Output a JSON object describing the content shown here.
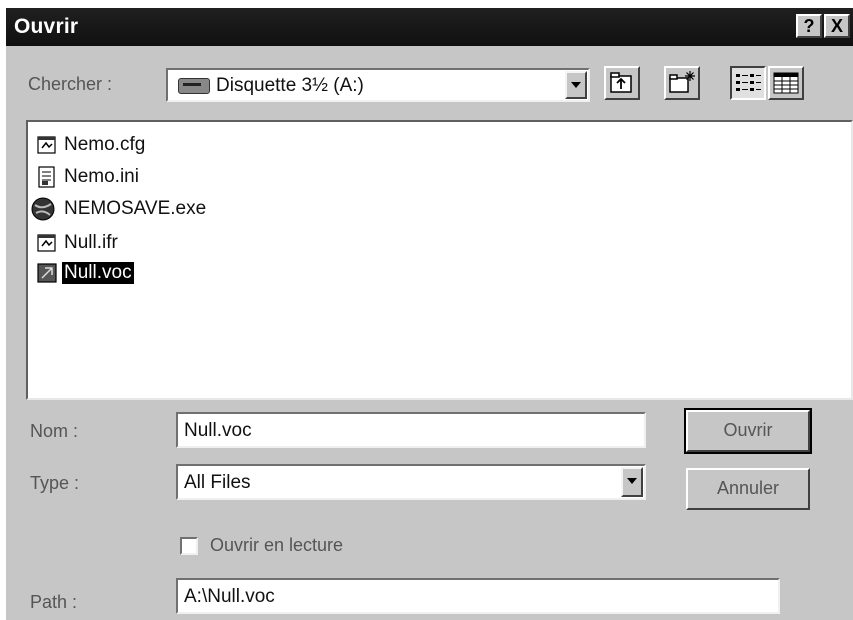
{
  "window": {
    "title": "Ouvrir"
  },
  "title_buttons": {
    "help": "?",
    "close": "X"
  },
  "lookin": {
    "label": "Chercher :",
    "value": "Disquette 3½ (A:)"
  },
  "files": [
    {
      "name": "Nemo.cfg",
      "icon": "config-file-icon",
      "selected": false
    },
    {
      "name": "Nemo.ini",
      "icon": "ini-file-icon",
      "selected": false
    },
    {
      "name": "NEMOSAVE.exe",
      "icon": "exe-file-icon",
      "selected": false
    },
    {
      "name": "Null.ifr",
      "icon": "config-file-icon",
      "selected": false
    },
    {
      "name": "Null.voc",
      "icon": "voc-file-icon",
      "selected": true
    }
  ],
  "filename": {
    "label": "Nom :",
    "value": "Null.voc"
  },
  "filetype": {
    "label": "Type :",
    "value": "All Files"
  },
  "readonly": {
    "label": "Ouvrir en lecture",
    "checked": false
  },
  "path": {
    "label": "Path :",
    "value": "A:\\Null.voc"
  },
  "buttons": {
    "open": "Ouvrir",
    "cancel": "Annuler"
  }
}
